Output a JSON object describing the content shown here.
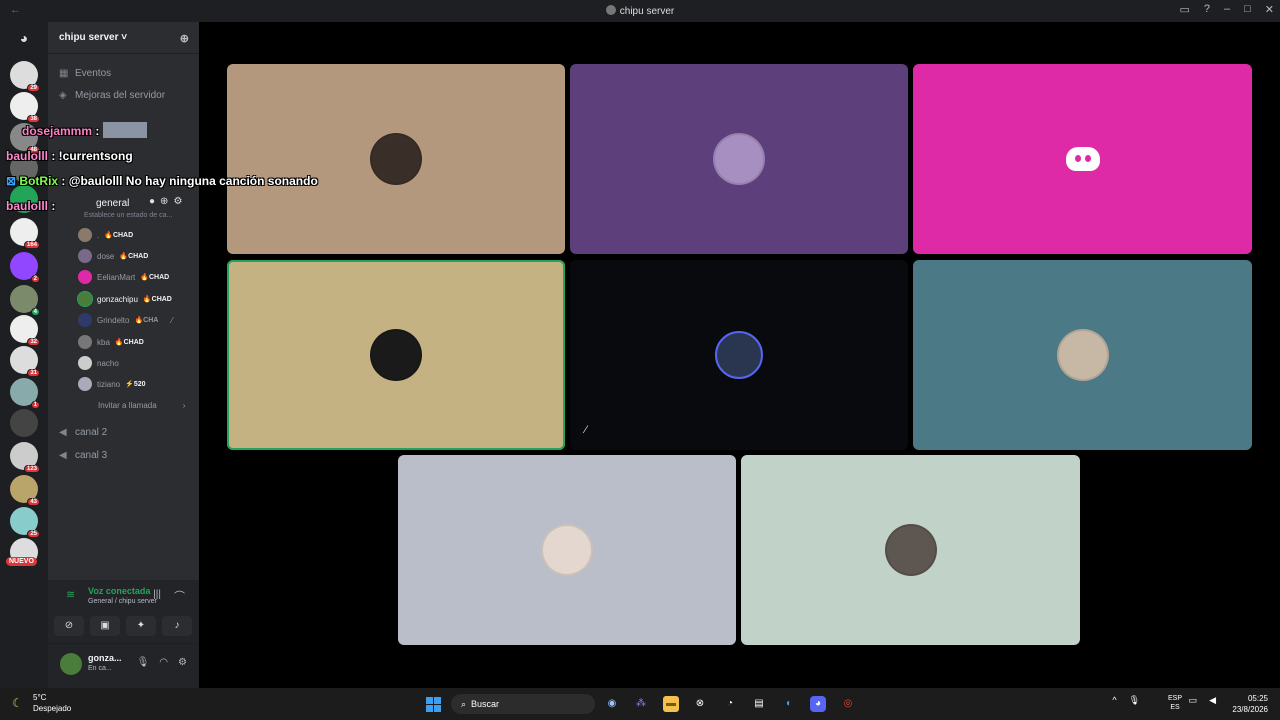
{
  "window": {
    "title": "chipu server",
    "nav_back": "←",
    "nav_forward": "→",
    "controls": [
      "inbox-icon",
      "help-icon",
      "minimize",
      "maximize",
      "close"
    ]
  },
  "guilds": [
    {
      "badge": "29"
    },
    {
      "badge": "38"
    },
    {
      "badge": "48"
    },
    {
      "badge": "27"
    },
    {
      "badge": ""
    },
    {
      "badge": "164"
    },
    {
      "badge": "2"
    },
    {
      "badge": "4"
    },
    {
      "badge": "32"
    },
    {
      "badge": "31"
    },
    {
      "badge": "1"
    },
    {
      "badge": ""
    },
    {
      "badge": "123"
    },
    {
      "badge": "43"
    },
    {
      "badge": "25"
    },
    {
      "badge": ""
    }
  ],
  "guilds_new_label": "NUEVO",
  "server": {
    "name": "chipu server",
    "chevron": "˅",
    "invite_icon": "add-user-icon",
    "channels_top": [
      {
        "icon": "calendar-icon",
        "label": "Eventos"
      },
      {
        "icon": "boost-icon",
        "label": "Mejoras del servidor"
      }
    ],
    "voice_channel_name": "general",
    "voice_channel_status": "Establece un estado de ca...",
    "members": [
      {
        "name": ".",
        "tag": "🔥CHAD"
      },
      {
        "name": "dose",
        "tag": "🔥CHAD"
      },
      {
        "name": "EelianMart",
        "tag": "🔥CHAD"
      },
      {
        "name": "gonzachipu",
        "tag": "🔥CHAD"
      },
      {
        "name": "Grindelto",
        "tag": "🔥CHA"
      },
      {
        "name": "kba",
        "tag": "🔥CHAD"
      },
      {
        "name": "nacho",
        "tag": ""
      },
      {
        "name": "tiziano",
        "tag": "⚡520"
      }
    ],
    "invite_call": "Invitar a llamada",
    "other_channels": [
      "canal 2",
      "canal 3"
    ]
  },
  "voice": {
    "status": "Voz conectada",
    "location": "General / chipu server",
    "controls": [
      "camera-off-icon",
      "screen-share-icon",
      "activities-icon",
      "soundboard-icon"
    ]
  },
  "user": {
    "name": "gonza...",
    "status": "En ca..."
  },
  "tiles": [
    {
      "color": "#b4987e"
    },
    {
      "color": "#5d3f7c"
    },
    {
      "color": "#df2aa7"
    },
    {
      "color": "#c5b283"
    },
    {
      "color": "#090a0d"
    },
    {
      "color": "#4b7a86"
    },
    {
      "color": "#b9bec9"
    },
    {
      "color": "#c1d3c8"
    }
  ],
  "chat_overlay": [
    {
      "name": "dosejammm",
      "message": ""
    },
    {
      "name": "baulolll",
      "message": "!currentsong"
    },
    {
      "name": "BotRix",
      "message": "@baulolll No hay ninguna canción sonando"
    },
    {
      "name": "baulolll",
      "message": ""
    }
  ],
  "taskbar": {
    "temperature": "5°C",
    "weather": "Despejado",
    "search_placeholder": "Buscar",
    "lang_top": "ESP",
    "lang_bottom": "ES",
    "time": "05:25",
    "date": "23/8/2026"
  }
}
